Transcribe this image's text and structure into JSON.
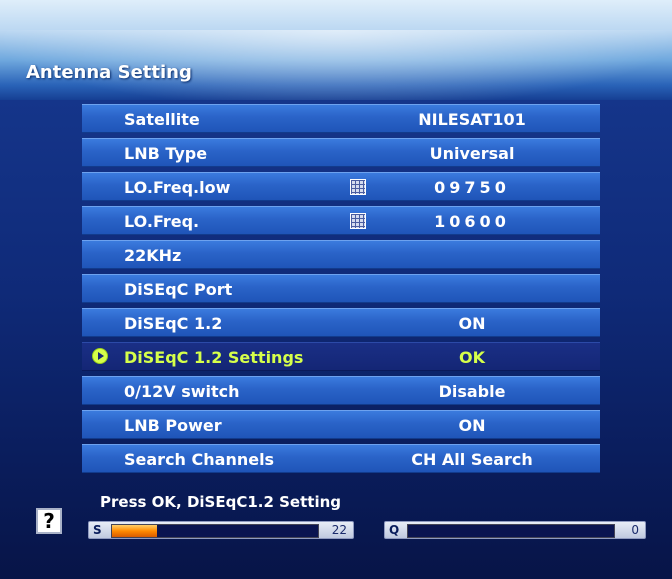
{
  "header": {
    "title": "Antenna Setting"
  },
  "menu": {
    "items": [
      {
        "label": "Satellite",
        "value": "NILESAT101"
      },
      {
        "label": "LNB Type",
        "value": "Universal"
      },
      {
        "label": "LO.Freq.low",
        "value": "09750"
      },
      {
        "label": "LO.Freq.",
        "value": "10600"
      },
      {
        "label": "22KHz",
        "value": ""
      },
      {
        "label": "DiSEqC Port",
        "value": ""
      },
      {
        "label": "DiSEqC 1.2",
        "value": "ON"
      },
      {
        "label": "DiSEqC 1.2 Settings",
        "value": "OK"
      },
      {
        "label": "0/12V switch",
        "value": "Disable"
      },
      {
        "label": "LNB Power",
        "value": "ON"
      },
      {
        "label": "Search Channels",
        "value": "CH All Search"
      }
    ],
    "selected_index": 7
  },
  "footer": {
    "help_glyph": "?",
    "help_text": "Press OK, DiSEqC1.2 Setting",
    "signal": {
      "letter": "S",
      "value": "22",
      "level_percent": 22
    },
    "quality": {
      "letter": "Q",
      "value": "0",
      "level_percent": 0
    }
  },
  "colors": {
    "row_blue": "#2a63c8",
    "selected_row": "#142675",
    "highlight_text": "#d6ff4a",
    "signal_fill": "#ff8a00"
  },
  "icons": [
    "keypad-icon",
    "cursor-arrow-icon",
    "help-icon"
  ]
}
